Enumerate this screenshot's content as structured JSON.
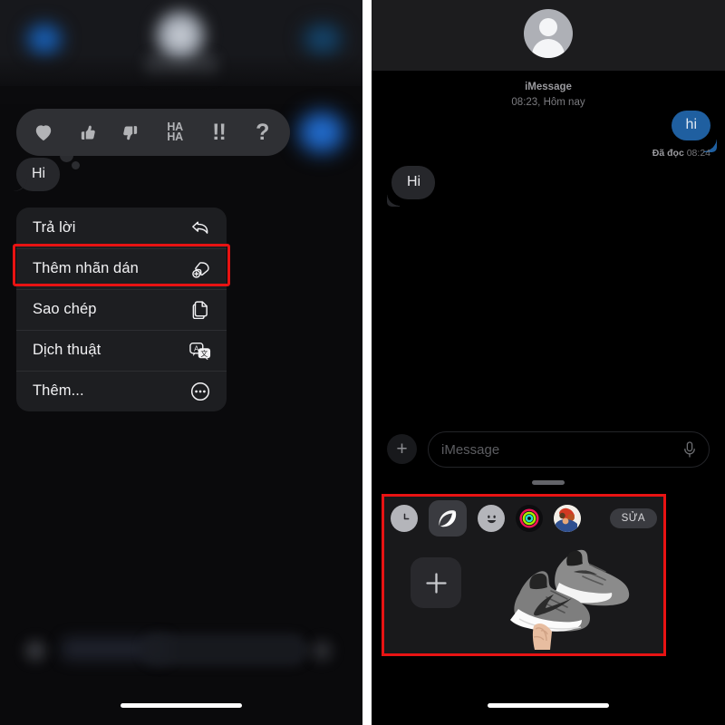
{
  "left_panel": {
    "name": "imessage-context-menu-screen",
    "reaction_bar": {
      "name": "tapback-reaction-bar",
      "reactions": [
        {
          "id": "heart",
          "label": "Heart",
          "icon": "heart-icon"
        },
        {
          "id": "thumbs-up",
          "label": "Thumbs up",
          "icon": "thumbs-up-icon"
        },
        {
          "id": "thumbs-down",
          "label": "Thumbs down",
          "icon": "thumbs-down-icon"
        },
        {
          "id": "haha",
          "label": "HA HA",
          "line1": "HA",
          "line2": "HA",
          "icon": "haha-icon"
        },
        {
          "id": "exclamation",
          "label": "!!",
          "text": "!!",
          "icon": "double-exclamation-icon"
        },
        {
          "id": "question",
          "label": "?",
          "text": "?",
          "icon": "question-mark-icon"
        }
      ]
    },
    "focused_message": {
      "text": "Hi",
      "sender": "incoming"
    },
    "context_menu": {
      "items": [
        {
          "label": "Trả lời",
          "icon": "reply-arrow-icon",
          "highlighted": false
        },
        {
          "label": "Thêm nhãn dán",
          "icon": "add-sticker-icon",
          "highlighted": true
        },
        {
          "label": "Sao chép",
          "icon": "copy-icon",
          "highlighted": false
        },
        {
          "label": "Dịch thuật",
          "icon": "translate-icon",
          "highlighted": false
        },
        {
          "label": "Thêm...",
          "icon": "more-ellipsis-icon",
          "highlighted": false
        }
      ]
    }
  },
  "right_panel": {
    "name": "imessage-sticker-drawer-screen",
    "header": {
      "avatar": "default-person-avatar"
    },
    "conversation": {
      "service_label": "iMessage",
      "timestamp": "08:23, Hôm nay",
      "messages": [
        {
          "text": "hi",
          "sender": "outgoing",
          "receipt": "Đã đọc",
          "receipt_time": "08:24"
        },
        {
          "text": "Hi",
          "sender": "incoming"
        }
      ]
    },
    "composer": {
      "add_button": "+",
      "placeholder": "iMessage",
      "mic_icon": "microphone-icon"
    },
    "sticker_drawer": {
      "tabs": [
        {
          "id": "recents",
          "icon": "clock-icon",
          "selected": false
        },
        {
          "id": "stickers",
          "icon": "sticker-icon",
          "selected": true
        },
        {
          "id": "emoji",
          "icon": "smiley-icon",
          "selected": false
        },
        {
          "id": "activity",
          "icon": "activity-rings-icon",
          "selected": false
        },
        {
          "id": "memoji",
          "icon": "memoji-avatar-icon",
          "selected": false
        }
      ],
      "edit_label": "SỬA",
      "add_sticker_button": "+",
      "stickers": [
        {
          "id": "nike-sneakers",
          "label": "Grey Nike sneakers held in hand"
        }
      ]
    }
  },
  "colors": {
    "highlight_red": "#e81313",
    "outgoing_bubble": "#1f5fa0",
    "incoming_bubble": "#26272b",
    "drawer_bg": "#19191b",
    "selected_tab": "#3a3b40"
  }
}
